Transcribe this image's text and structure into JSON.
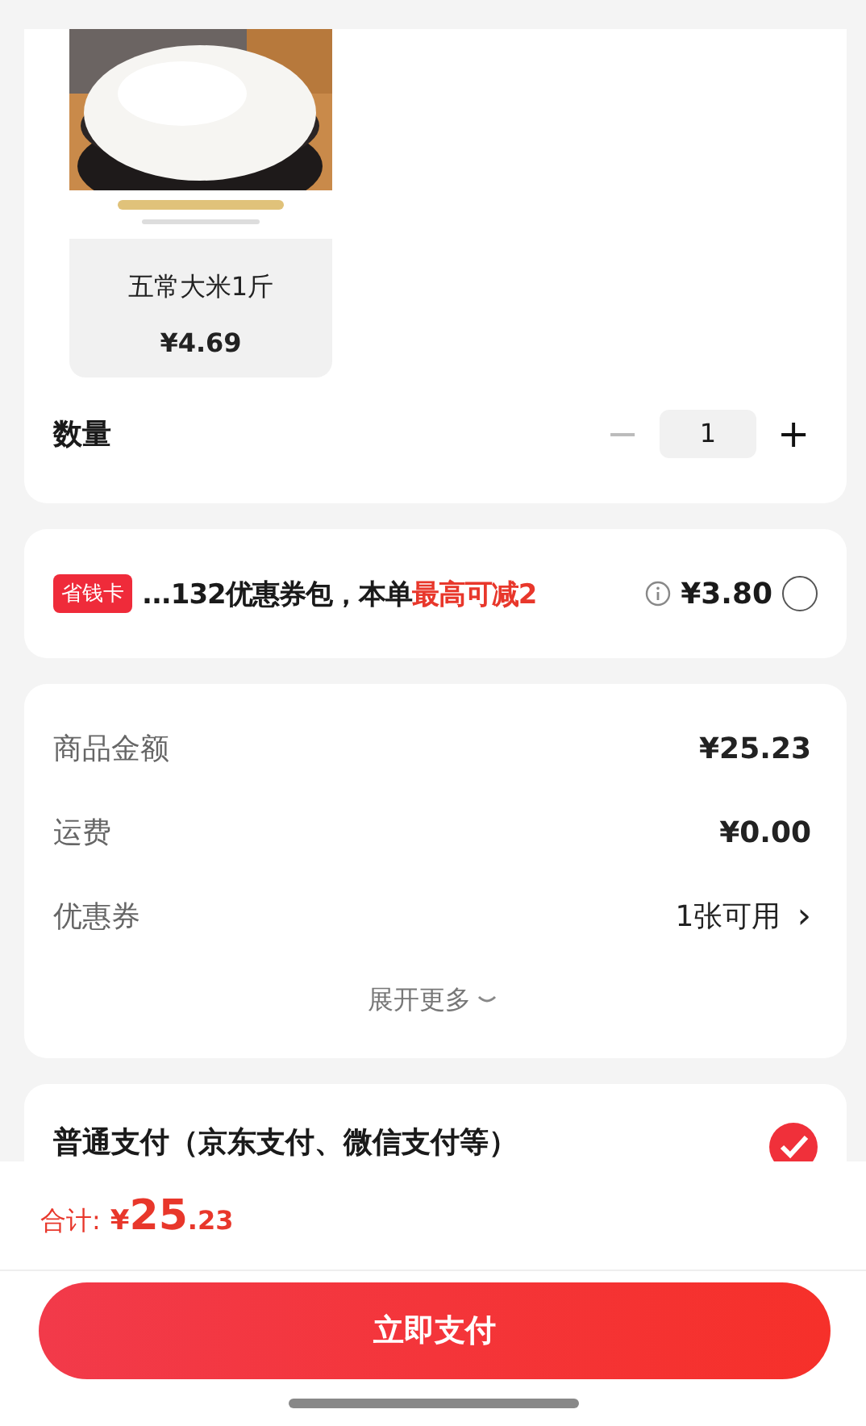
{
  "product": {
    "name": "五常大米1斤",
    "price": "¥4.69"
  },
  "quantity": {
    "label": "数量",
    "value": "1",
    "minus": {
      "symbol": "−",
      "disabled": true
    },
    "plus": {
      "symbol": "+",
      "disabled": false
    }
  },
  "promo": {
    "badge": "省钱卡",
    "text": "...132优惠券包，本单",
    "highlight": "最高可减2",
    "amount": "¥3.80",
    "selected": false
  },
  "summary": {
    "rows": [
      {
        "label": "商品金额",
        "value": "¥25.23",
        "kind": "plain"
      },
      {
        "label": "运费",
        "value": "¥0.00",
        "kind": "plain"
      },
      {
        "label": "优惠券",
        "value": "1张可用",
        "kind": "link",
        "arrow": "›"
      }
    ],
    "more": "展开更多"
  },
  "payment": {
    "label": "普通支付（京东支付、微信支付等）",
    "selected": true
  },
  "footer": {
    "total_label": "合计:",
    "currency": "¥",
    "integer": "25",
    "decimal": ".23",
    "button": "立即支付"
  }
}
